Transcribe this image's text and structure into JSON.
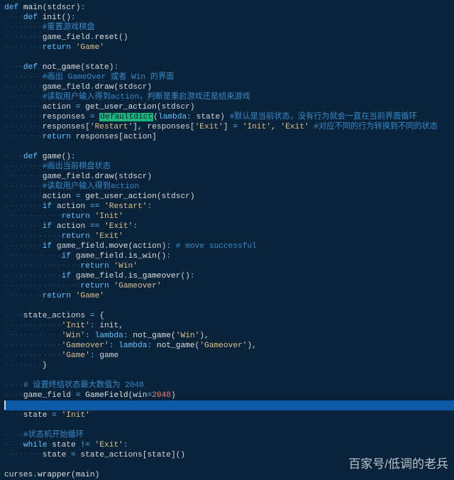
{
  "meta": {
    "watermark": "百家号/低调的老兵"
  },
  "lines": [
    {
      "seg": [
        [
          "kw",
          "def "
        ],
        [
          "fn",
          "main"
        ],
        [
          "pa",
          "(stdscr)"
        ],
        [
          "op",
          ":"
        ]
      ]
    },
    {
      "ind": 1,
      "seg": [
        [
          "kw",
          "def "
        ],
        [
          "fn",
          "init"
        ],
        [
          "pa",
          "()"
        ],
        [
          "op",
          ":"
        ]
      ]
    },
    {
      "ind": 2,
      "seg": [
        [
          "com",
          "#重置游戏棋盘"
        ]
      ]
    },
    {
      "ind": 2,
      "seg": [
        [
          "pa",
          "game_field"
        ],
        [
          "op",
          "."
        ],
        [
          "fn",
          "reset"
        ],
        [
          "pa",
          "()"
        ]
      ]
    },
    {
      "ind": 2,
      "seg": [
        [
          "kw",
          "return "
        ],
        [
          "str",
          "'Game'"
        ]
      ]
    },
    {
      "blank": true
    },
    {
      "ind": 1,
      "seg": [
        [
          "kw",
          "def "
        ],
        [
          "fn",
          "not_game"
        ],
        [
          "pa",
          "(state)"
        ],
        [
          "op",
          ":"
        ]
      ]
    },
    {
      "ind": 2,
      "seg": [
        [
          "com",
          "#画出 GameOver 或者 Win 的界面"
        ]
      ]
    },
    {
      "ind": 2,
      "seg": [
        [
          "pa",
          "game_field"
        ],
        [
          "op",
          "."
        ],
        [
          "fn",
          "draw"
        ],
        [
          "pa",
          "(stdscr)"
        ]
      ]
    },
    {
      "ind": 2,
      "seg": [
        [
          "com",
          "#读取用户输入得到action，判断是重启游戏还是结束游戏"
        ]
      ]
    },
    {
      "ind": 2,
      "seg": [
        [
          "pa",
          "action "
        ],
        [
          "op",
          "="
        ],
        [
          "pa",
          " "
        ],
        [
          "fn",
          "get_user_action"
        ],
        [
          "pa",
          "(stdscr)"
        ]
      ]
    },
    {
      "ind": 2,
      "seg": [
        [
          "pa",
          "responses "
        ],
        [
          "op",
          "="
        ],
        [
          "pa",
          " "
        ],
        [
          "hl",
          "defaultdict"
        ],
        [
          "pa",
          "("
        ],
        [
          "kw",
          "lambda"
        ],
        [
          "op",
          ":"
        ],
        [
          "pa",
          " state) "
        ],
        [
          "com",
          "#默认是当前状态，没有行为就会一直在当前界面循环"
        ]
      ]
    },
    {
      "ind": 2,
      "seg": [
        [
          "pa",
          "responses["
        ],
        [
          "str",
          "'Restart'"
        ],
        [
          "pa",
          "], responses["
        ],
        [
          "str",
          "'Exit'"
        ],
        [
          "pa",
          "] "
        ],
        [
          "op",
          "="
        ],
        [
          "pa",
          " "
        ],
        [
          "str",
          "'Init'"
        ],
        [
          "pa",
          ", "
        ],
        [
          "str",
          "'Exit'"
        ],
        [
          "pa",
          " "
        ],
        [
          "com",
          "#对应不同的行为转换到不同的状态"
        ]
      ]
    },
    {
      "ind": 2,
      "seg": [
        [
          "kw",
          "return "
        ],
        [
          "pa",
          "responses[action]"
        ]
      ]
    },
    {
      "blank": true
    },
    {
      "ind": 1,
      "seg": [
        [
          "kw",
          "def "
        ],
        [
          "fn",
          "game"
        ],
        [
          "pa",
          "()"
        ],
        [
          "op",
          ":"
        ]
      ]
    },
    {
      "ind": 2,
      "seg": [
        [
          "com",
          "#画出当前棋盘状态"
        ]
      ]
    },
    {
      "ind": 2,
      "seg": [
        [
          "pa",
          "game_field"
        ],
        [
          "op",
          "."
        ],
        [
          "fn",
          "draw"
        ],
        [
          "pa",
          "(stdscr)"
        ]
      ]
    },
    {
      "ind": 2,
      "seg": [
        [
          "com",
          "#读取用户输入得到action"
        ]
      ]
    },
    {
      "ind": 2,
      "seg": [
        [
          "pa",
          "action "
        ],
        [
          "op",
          "="
        ],
        [
          "pa",
          " "
        ],
        [
          "fn",
          "get_user_action"
        ],
        [
          "pa",
          "(stdscr)"
        ]
      ]
    },
    {
      "ind": 2,
      "seg": [
        [
          "kw",
          "if "
        ],
        [
          "pa",
          "action "
        ],
        [
          "op",
          "=="
        ],
        [
          "pa",
          " "
        ],
        [
          "str",
          "'Restart'"
        ],
        [
          "op",
          ":"
        ]
      ]
    },
    {
      "ind": 3,
      "seg": [
        [
          "kw",
          "return "
        ],
        [
          "str",
          "'Init'"
        ]
      ]
    },
    {
      "ind": 2,
      "seg": [
        [
          "kw",
          "if "
        ],
        [
          "pa",
          "action "
        ],
        [
          "op",
          "=="
        ],
        [
          "pa",
          " "
        ],
        [
          "str",
          "'Exit'"
        ],
        [
          "op",
          ":"
        ]
      ]
    },
    {
      "ind": 3,
      "seg": [
        [
          "kw",
          "return "
        ],
        [
          "str",
          "'Exit'"
        ]
      ]
    },
    {
      "ind": 2,
      "seg": [
        [
          "kw",
          "if "
        ],
        [
          "pa",
          "game_field"
        ],
        [
          "op",
          "."
        ],
        [
          "fn",
          "move"
        ],
        [
          "pa",
          "(action)"
        ],
        [
          "op",
          ":"
        ],
        [
          "pa",
          " "
        ],
        [
          "com",
          "# move successful"
        ]
      ]
    },
    {
      "ind": 3,
      "seg": [
        [
          "kw",
          "if "
        ],
        [
          "pa",
          "game_field"
        ],
        [
          "op",
          "."
        ],
        [
          "fn",
          "is_win"
        ],
        [
          "pa",
          "()"
        ],
        [
          "op",
          ":"
        ]
      ]
    },
    {
      "ind": 4,
      "seg": [
        [
          "kw",
          "return "
        ],
        [
          "str",
          "'Win'"
        ]
      ]
    },
    {
      "ind": 3,
      "seg": [
        [
          "kw",
          "if "
        ],
        [
          "pa",
          "game_field"
        ],
        [
          "op",
          "."
        ],
        [
          "fn",
          "is_gameover"
        ],
        [
          "pa",
          "()"
        ],
        [
          "op",
          ":"
        ]
      ]
    },
    {
      "ind": 4,
      "seg": [
        [
          "kw",
          "return "
        ],
        [
          "str",
          "'Gameover'"
        ]
      ]
    },
    {
      "ind": 2,
      "seg": [
        [
          "kw",
          "return "
        ],
        [
          "str",
          "'Game'"
        ]
      ]
    },
    {
      "blank": true
    },
    {
      "ind": 1,
      "seg": [
        [
          "pa",
          "state_actions "
        ],
        [
          "op",
          "="
        ],
        [
          "pa",
          " {"
        ]
      ]
    },
    {
      "ind": 3,
      "seg": [
        [
          "str",
          "'Init'"
        ],
        [
          "op",
          ":"
        ],
        [
          "pa",
          " init,"
        ]
      ]
    },
    {
      "ind": 3,
      "seg": [
        [
          "str",
          "'Win'"
        ],
        [
          "op",
          ":"
        ],
        [
          "pa",
          " "
        ],
        [
          "kw",
          "lambda"
        ],
        [
          "op",
          ":"
        ],
        [
          "pa",
          " "
        ],
        [
          "fn",
          "not_game"
        ],
        [
          "pa",
          "("
        ],
        [
          "str",
          "'Win'"
        ],
        [
          "pa",
          "),"
        ]
      ]
    },
    {
      "ind": 3,
      "seg": [
        [
          "str",
          "'Gameover'"
        ],
        [
          "op",
          ":"
        ],
        [
          "pa",
          " "
        ],
        [
          "kw",
          "lambda"
        ],
        [
          "op",
          ":"
        ],
        [
          "pa",
          " "
        ],
        [
          "fn",
          "not_game"
        ],
        [
          "pa",
          "("
        ],
        [
          "str",
          "'Gameover'"
        ],
        [
          "pa",
          "),"
        ]
      ]
    },
    {
      "ind": 3,
      "seg": [
        [
          "str",
          "'Game'"
        ],
        [
          "op",
          ":"
        ],
        [
          "pa",
          " game"
        ]
      ]
    },
    {
      "ind": 2,
      "seg": [
        [
          "pa",
          "}"
        ]
      ]
    },
    {
      "blank": true
    },
    {
      "ind": 1,
      "seg": [
        [
          "com",
          "# 设置终结状态最大数值为 2048"
        ]
      ]
    },
    {
      "ind": 1,
      "seg": [
        [
          "pa",
          "game_field "
        ],
        [
          "op",
          "="
        ],
        [
          "pa",
          " "
        ],
        [
          "fn",
          "GameField"
        ],
        [
          "pa",
          "(win"
        ],
        [
          "op",
          "="
        ],
        [
          "num",
          "2048"
        ],
        [
          "pa",
          ")"
        ]
      ]
    },
    {
      "cursor": true
    },
    {
      "ind": 1,
      "seg": [
        [
          "pa",
          "state "
        ],
        [
          "op",
          "="
        ],
        [
          "pa",
          " "
        ],
        [
          "str",
          "'Init'"
        ]
      ]
    },
    {
      "blank": true
    },
    {
      "ind": 1,
      "seg": [
        [
          "com",
          "#状态机开始循环"
        ]
      ]
    },
    {
      "ind": 1,
      "seg": [
        [
          "kw",
          "while "
        ],
        [
          "pa",
          "state "
        ],
        [
          "op",
          "!="
        ],
        [
          "pa",
          " "
        ],
        [
          "str",
          "'Exit'"
        ],
        [
          "op",
          ":"
        ]
      ]
    },
    {
      "ind": 2,
      "seg": [
        [
          "pa",
          "state "
        ],
        [
          "op",
          "="
        ],
        [
          "pa",
          " state_actions[state]()"
        ]
      ]
    },
    {
      "blank": true
    },
    {
      "seg": [
        [
          "pa",
          "curses"
        ],
        [
          "op",
          "."
        ],
        [
          "fn",
          "wrapper"
        ],
        [
          "pa",
          "(main)"
        ]
      ]
    }
  ]
}
